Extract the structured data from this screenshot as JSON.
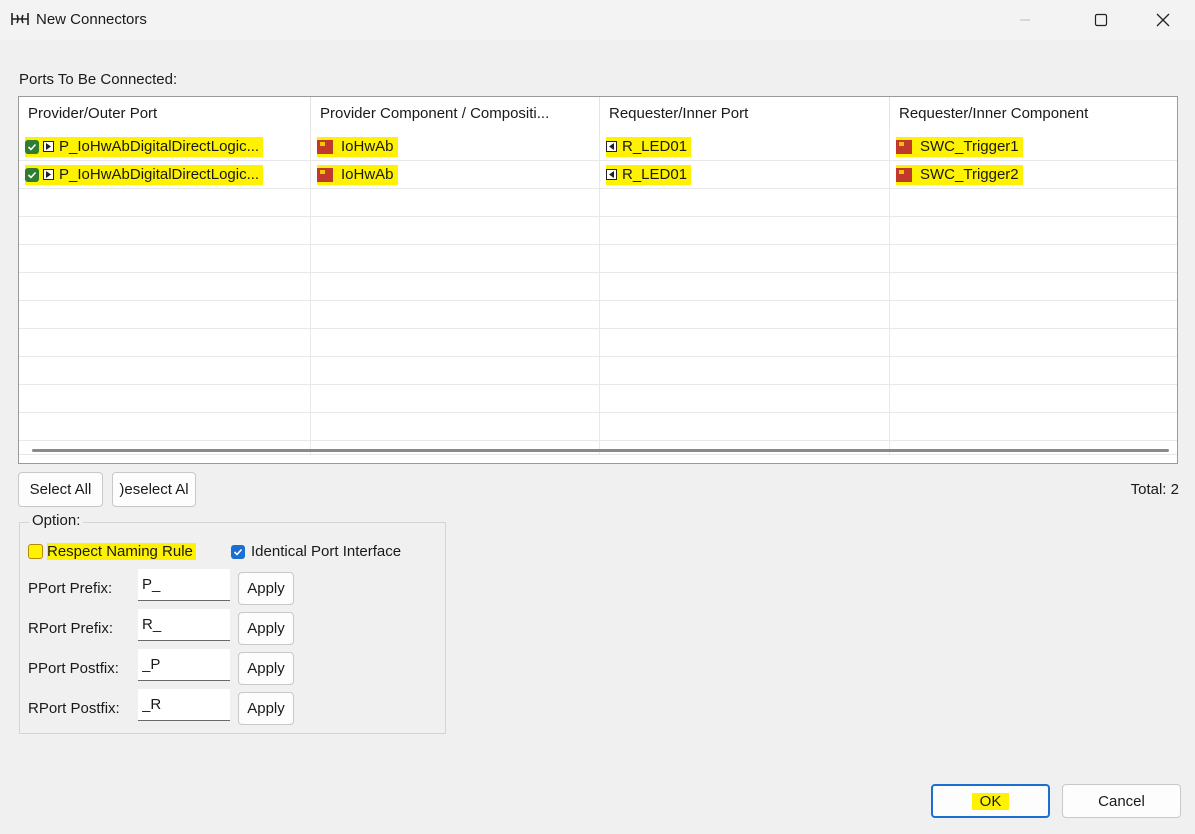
{
  "window": {
    "title": "New Connectors",
    "icon": "connector-icon",
    "controls": [
      "minimize-icon",
      "maximize-icon",
      "close-icon"
    ]
  },
  "ports_section": {
    "label": "Ports To Be Connected:",
    "columns": [
      "Provider/Outer Port",
      "Provider Component / Compositi...",
      "Requester/Inner Port",
      "Requester/Inner Component"
    ],
    "rows": [
      {
        "checked": true,
        "provider_port": "P_IoHwAbDigitalDirectLogic...",
        "provider_component": "IoHwAb",
        "requester_port": "R_LED01",
        "requester_component": "SWC_Trigger1"
      },
      {
        "checked": true,
        "provider_port": "P_IoHwAbDigitalDirectLogic...",
        "provider_component": "IoHwAb",
        "requester_port": "R_LED01",
        "requester_component": "SWC_Trigger2"
      }
    ]
  },
  "actions": {
    "select_all": "Select All",
    "deselect_all": ")eselect Al",
    "total": "Total: 2"
  },
  "options": {
    "legend": "Option:",
    "respect_naming_rule": {
      "label": "Respect Naming Rule",
      "checked": false
    },
    "identical_port_interface": {
      "label": "Identical Port Interface",
      "checked": true
    },
    "fields": [
      {
        "label": "PPort Prefix:",
        "value": "P_",
        "button": "Apply"
      },
      {
        "label": "RPort Prefix:",
        "value": "R_",
        "button": "Apply"
      },
      {
        "label": "PPort Postfix:",
        "value": "_P",
        "button": "Apply"
      },
      {
        "label": "RPort Postfix:",
        "value": "_R",
        "button": "Apply"
      }
    ]
  },
  "footer": {
    "ok": "OK",
    "cancel": "Cancel"
  },
  "colors": {
    "highlight": "#fff200",
    "accent": "#1a6fd0",
    "check_green": "#2e7d32"
  }
}
